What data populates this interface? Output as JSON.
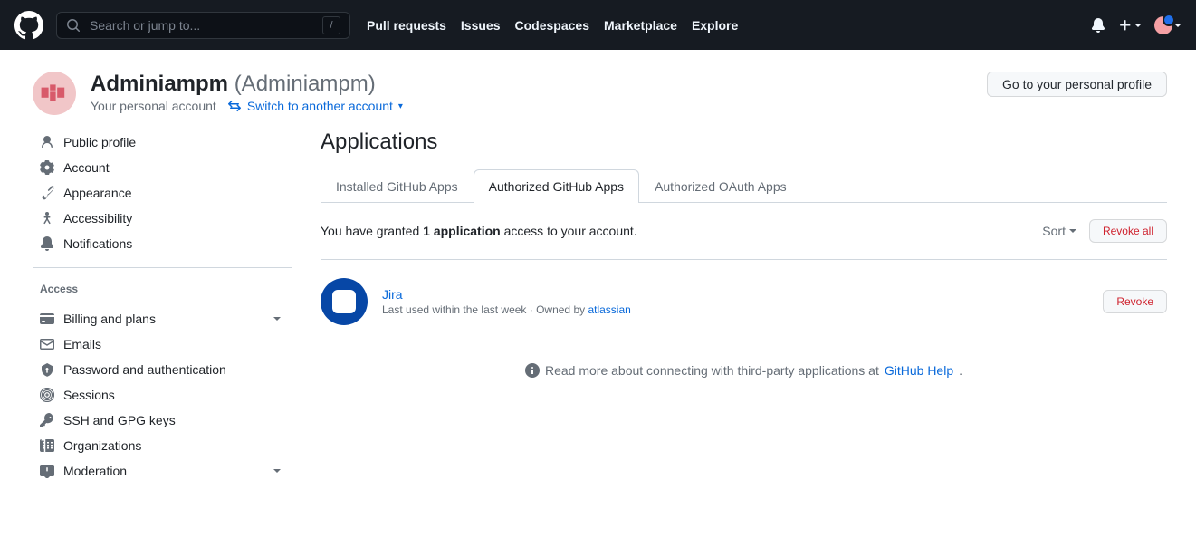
{
  "header": {
    "search_placeholder": "Search or jump to...",
    "search_key": "/",
    "nav": [
      "Pull requests",
      "Issues",
      "Codespaces",
      "Marketplace",
      "Explore"
    ]
  },
  "profile": {
    "display_name": "Adminiampm",
    "handle": "(Adminiampm)",
    "subtitle": "Your personal account",
    "switch_label": "Switch to another account",
    "go_button": "Go to your personal profile"
  },
  "sidebar": {
    "items": [
      {
        "label": "Public profile",
        "icon": "person"
      },
      {
        "label": "Account",
        "icon": "gear"
      },
      {
        "label": "Appearance",
        "icon": "paintbrush"
      },
      {
        "label": "Accessibility",
        "icon": "accessibility"
      },
      {
        "label": "Notifications",
        "icon": "bell"
      }
    ],
    "group_title": "Access",
    "access_items": [
      {
        "label": "Billing and plans",
        "icon": "credit-card",
        "expandable": true
      },
      {
        "label": "Emails",
        "icon": "mail"
      },
      {
        "label": "Password and authentication",
        "icon": "shield-lock"
      },
      {
        "label": "Sessions",
        "icon": "broadcast"
      },
      {
        "label": "SSH and GPG keys",
        "icon": "key"
      },
      {
        "label": "Organizations",
        "icon": "organization"
      },
      {
        "label": "Moderation",
        "icon": "report",
        "expandable": true
      }
    ]
  },
  "main": {
    "page_title": "Applications",
    "tabs": [
      "Installed GitHub Apps",
      "Authorized GitHub Apps",
      "Authorized OAuth Apps"
    ],
    "selected_tab": 1,
    "grant_text_a": "You have granted ",
    "grant_text_b": "1 application",
    "grant_text_c": " access to your account.",
    "sort_label": "Sort",
    "revoke_all": "Revoke all",
    "app": {
      "name": "Jira",
      "meta_prefix": "Last used within the last week · Owned by ",
      "owner": "atlassian",
      "revoke": "Revoke"
    },
    "footer_text": "Read more about connecting with third-party applications at ",
    "footer_link": "GitHub Help",
    "footer_suffix": "."
  }
}
